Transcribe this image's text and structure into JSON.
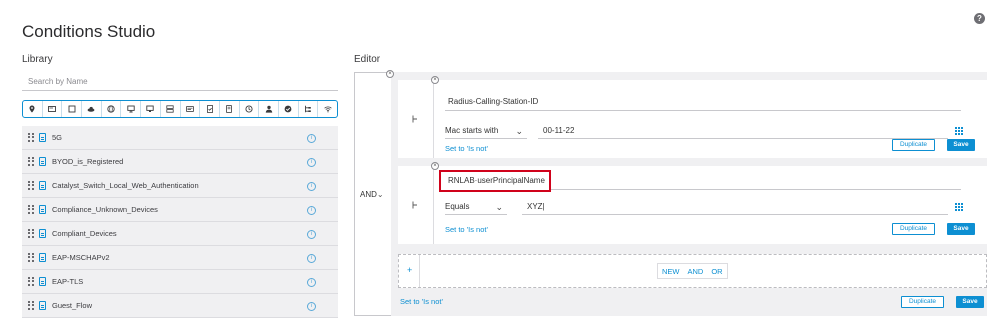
{
  "page": {
    "title": "Conditions Studio",
    "help_icon": "question-icon"
  },
  "library": {
    "heading": "Library",
    "search_placeholder": "Search by Name",
    "icon_filters": [
      "location-icon",
      "monitor-card-icon",
      "square-icon",
      "cloud-icon",
      "globe-icon",
      "desktop-icon",
      "monitor-icon",
      "switch-icon",
      "id-card-icon",
      "document-check-icon",
      "building-icon",
      "clock-icon",
      "user-icon",
      "check-circle-icon",
      "tree-icon",
      "wifi-icon"
    ],
    "items": [
      {
        "name": "5G"
      },
      {
        "name": "BYOD_is_Registered"
      },
      {
        "name": "Catalyst_Switch_Local_Web_Authentication"
      },
      {
        "name": "Compliance_Unknown_Devices"
      },
      {
        "name": "Compliant_Devices"
      },
      {
        "name": "EAP-MSCHAPv2"
      },
      {
        "name": "EAP-TLS"
      },
      {
        "name": "Guest_Flow"
      }
    ]
  },
  "editor": {
    "heading": "Editor",
    "operator": "AND",
    "conditions": [
      {
        "attribute": "Radius-Calling-Station-ID",
        "operator": "Mac starts with",
        "value": "00-11-22",
        "set_not": "Set to 'Is not'",
        "duplicate": "Duplicate",
        "save": "Save"
      },
      {
        "attribute": "RNLAB·userPrincipalName",
        "operator": "Equals",
        "value": "XYZ|",
        "set_not": "Set to 'Is not'",
        "duplicate": "Duplicate",
        "save": "Save"
      }
    ],
    "new_choices": {
      "plus": "+",
      "new": "NEW",
      "and": "AND",
      "or": "OR"
    },
    "footer": {
      "set_not": "Set to 'Is not'",
      "duplicate": "Duplicate",
      "save": "Save"
    }
  },
  "colors": {
    "accent": "#0d8fd2",
    "highlight": "#d0021b",
    "panel": "#f0f0f2"
  }
}
